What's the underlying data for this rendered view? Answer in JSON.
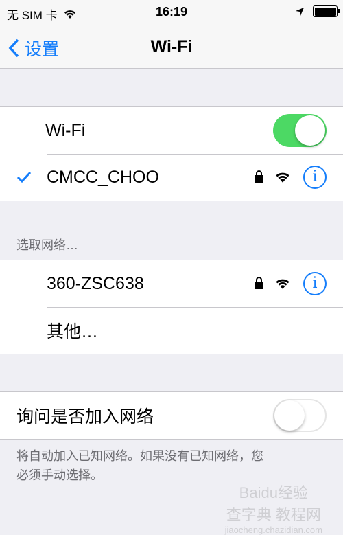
{
  "status_bar": {
    "carrier": "无 SIM 卡",
    "time": "16:19"
  },
  "nav": {
    "back_label": "设置",
    "title": "Wi-Fi"
  },
  "wifi_section": {
    "wifi_label": "Wi-Fi",
    "wifi_on": true,
    "connected_network": "CMCC_CHOO",
    "connected_checked": true
  },
  "networks_header": "选取网络…",
  "networks": [
    {
      "name": "360-ZSC638",
      "secured": true
    },
    {
      "name": "其他…"
    }
  ],
  "ask_join": {
    "label": "询问是否加入网络",
    "on": false
  },
  "footer": {
    "line1": "将自动加入已知网络。如果没有已知网络，您",
    "line2": "必须手动选择。"
  },
  "watermark": {
    "top": "Baidu经验",
    "middle": "查字典 教程网",
    "bottom": "jiaocheng.chazidian.com"
  },
  "colors": {
    "accent": "#157efb",
    "toggle_on": "#4cd964"
  }
}
